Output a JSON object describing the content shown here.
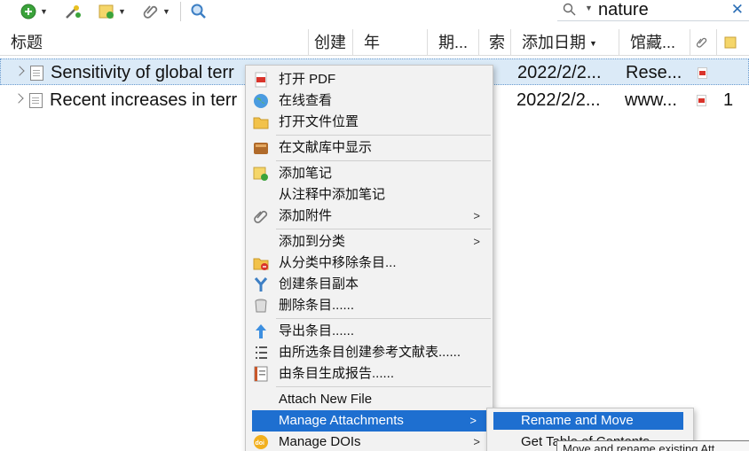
{
  "search": {
    "value": "nature"
  },
  "columns": [
    {
      "label": "标题"
    },
    {
      "label": "创建"
    },
    {
      "label": "年"
    },
    {
      "label": "期..."
    },
    {
      "label": "索"
    },
    {
      "label": "添加日期"
    },
    {
      "label": "馆藏..."
    }
  ],
  "rows": [
    {
      "title": "Sensitivity of global terr",
      "date_added": "2022/2/2...",
      "library": "Rese...",
      "count": ""
    },
    {
      "title": "Recent increases in terr",
      "date_added": "2022/2/2...",
      "library": "www...",
      "count": "1"
    }
  ],
  "menu": {
    "items": [
      {
        "label": "打开 PDF",
        "icon": "pdf-icon"
      },
      {
        "label": "在线查看",
        "icon": "globe-icon"
      },
      {
        "label": "打开文件位置",
        "icon": "folder-icon"
      },
      {
        "label": "在文献库中显示",
        "icon": "library-icon"
      },
      {
        "label": "添加笔记",
        "icon": "add-note-icon"
      },
      {
        "label": "从注释中添加笔记",
        "icon": ""
      },
      {
        "label": "添加附件",
        "icon": "paperclip-icon"
      },
      {
        "label": "添加到分类",
        "icon": ""
      },
      {
        "label": "从分类中移除条目...",
        "icon": "remove-from-collection-icon"
      },
      {
        "label": "创建条目副本",
        "icon": "duplicate-icon"
      },
      {
        "label": "删除条目......",
        "icon": "trash-icon"
      },
      {
        "label": "导出条目......",
        "icon": "export-icon"
      },
      {
        "label": "由所选条目创建参考文献表......",
        "icon": "bibliography-icon"
      },
      {
        "label": "由条目生成报告......",
        "icon": "report-icon"
      },
      {
        "label": "Attach New File",
        "icon": ""
      },
      {
        "label": "Manage Attachments",
        "icon": ""
      },
      {
        "label": "Manage DOIs",
        "icon": "doi-icon"
      }
    ]
  },
  "submenu": {
    "items": [
      {
        "label": "Rename and Move"
      },
      {
        "label": "Get Table of Contents"
      }
    ]
  },
  "tooltip": {
    "text": "Move and rename existing Att"
  },
  "colors": {
    "accent": "#1e6fd0",
    "selected_row": "#dbeaf7",
    "menu_bg": "#f2f2f2"
  }
}
